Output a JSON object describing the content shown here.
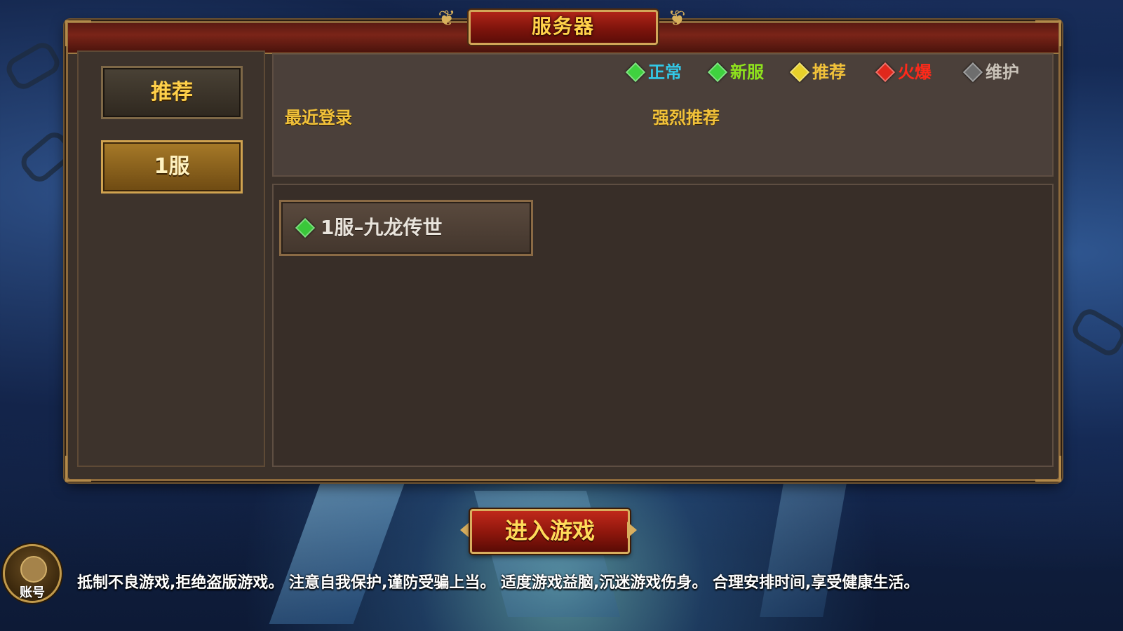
{
  "title": "服务器",
  "legend": [
    {
      "label": "正常",
      "color": "#3fd23f",
      "text_color": "#33c9e8"
    },
    {
      "label": "新服",
      "color": "#3fd23f",
      "text_color": "#8ee21d"
    },
    {
      "label": "推荐",
      "color": "#e8d12a",
      "text_color": "#f2c23a"
    },
    {
      "label": "火爆",
      "color": "#e0281c",
      "text_color": "#ff2a1a"
    },
    {
      "label": "维护",
      "color": "#6e6e6e",
      "text_color": "#c9c2b8"
    }
  ],
  "left_tabs": [
    {
      "label": "推荐",
      "selected": false
    },
    {
      "label": "1服",
      "selected": true
    }
  ],
  "sections": {
    "recent_login": "最近登录",
    "strong_recommend": "强烈推荐"
  },
  "servers": [
    {
      "name": "1服–九龙传世",
      "status_color": "#3ac83a"
    }
  ],
  "enter_button": "进入游戏",
  "account_label": "账号",
  "notice": "抵制不良游戏,拒绝盗版游戏。 注意自我保护,谨防受骗上当。 适度游戏益脑,沉迷游戏伤身。 合理安排时间,享受健康生活。"
}
